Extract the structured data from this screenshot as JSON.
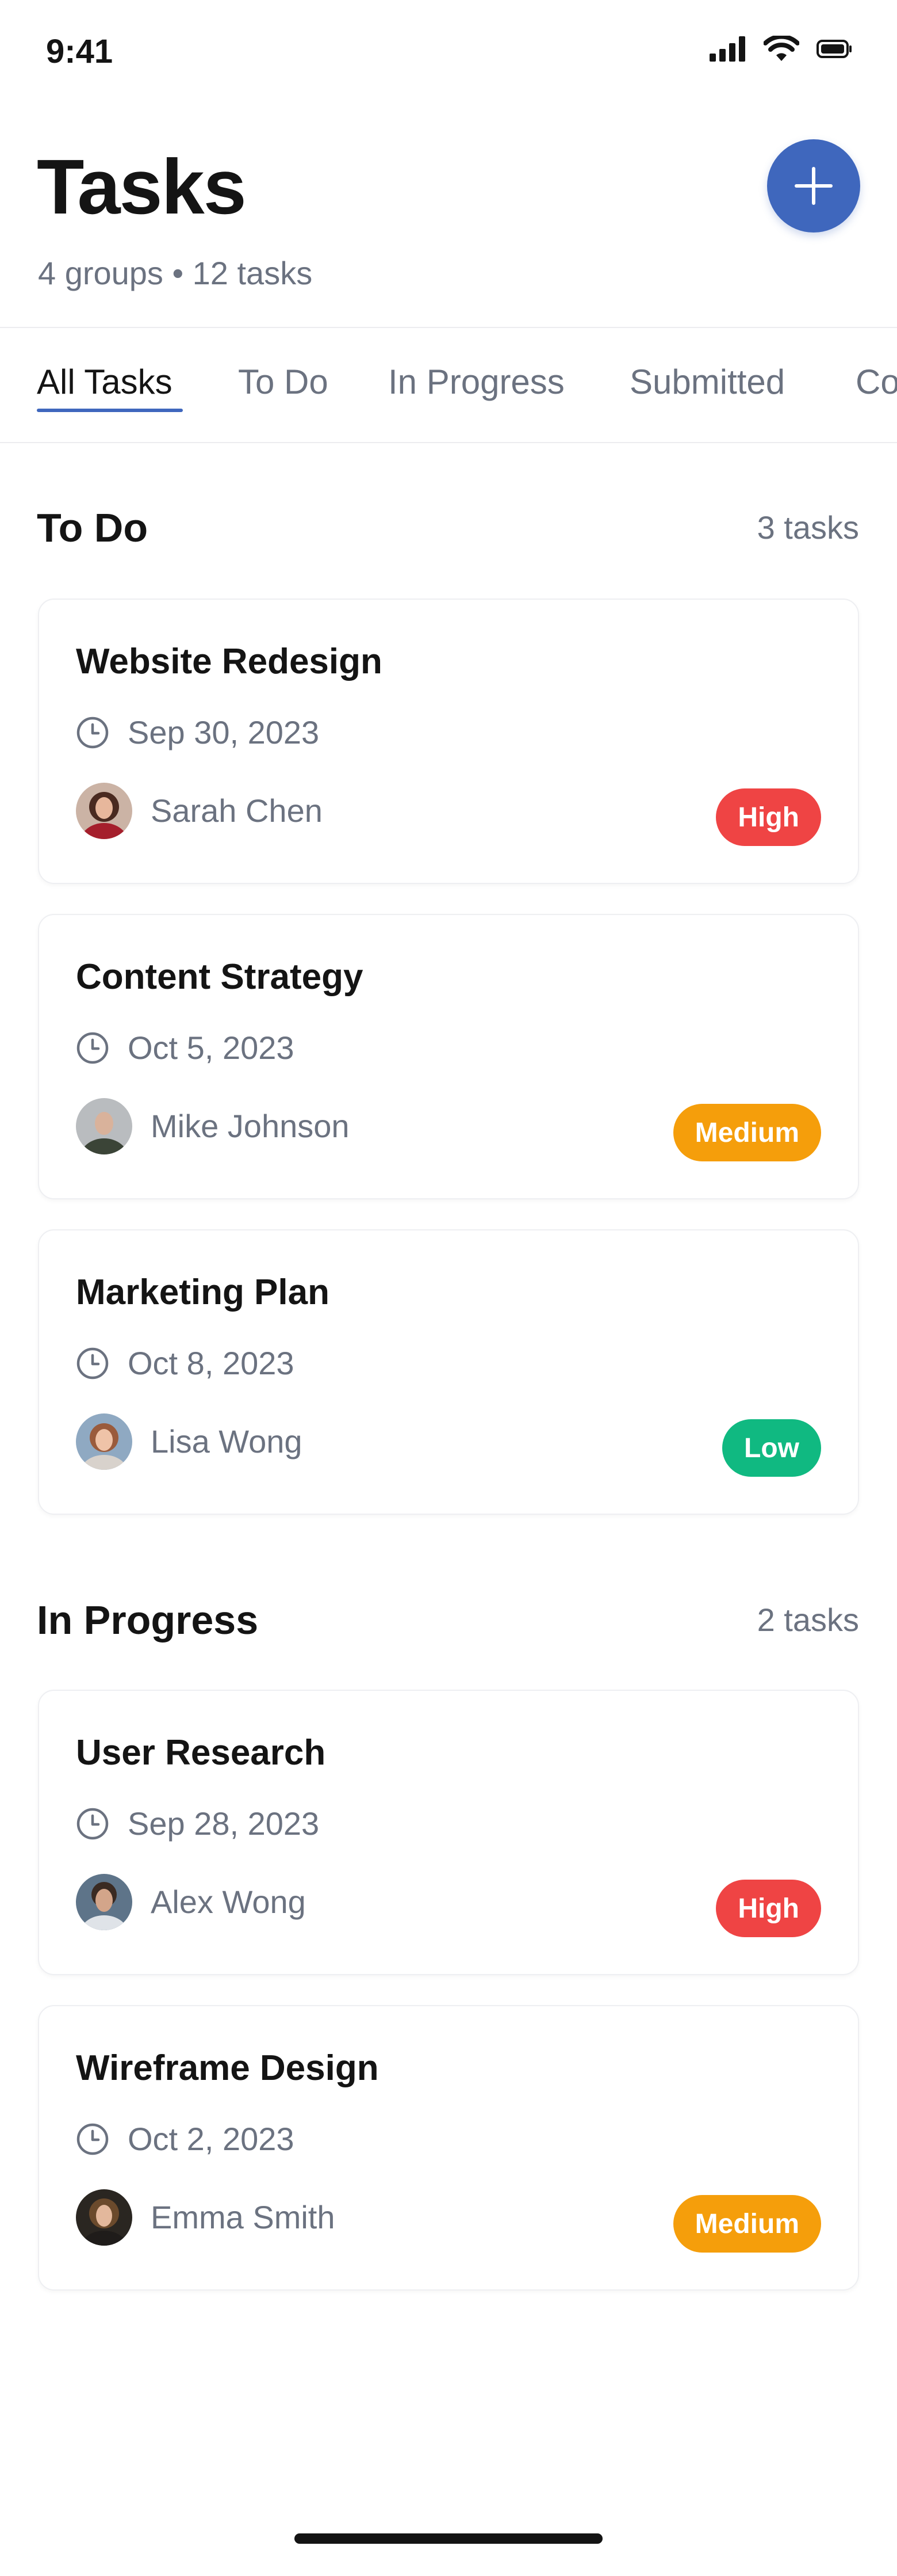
{
  "status_bar": {
    "time": "9:41"
  },
  "header": {
    "title": "Tasks",
    "subtitle": "4 groups • 12 tasks"
  },
  "tabs": [
    {
      "label": "All Tasks",
      "active": true
    },
    {
      "label": "To Do",
      "active": false
    },
    {
      "label": "In Progress",
      "active": false
    },
    {
      "label": "Submitted",
      "active": false
    },
    {
      "label": "Co",
      "active": false
    }
  ],
  "sections": [
    {
      "title": "To Do",
      "count": "3 tasks",
      "tasks": [
        {
          "title": "Website Redesign",
          "date": "Sep 30, 2023",
          "assignee": "Sarah Chen",
          "priority": "High",
          "priority_color": "#ef4444"
        },
        {
          "title": "Content Strategy",
          "date": "Oct 5, 2023",
          "assignee": "Mike Johnson",
          "priority": "Medium",
          "priority_color": "#f59e0b"
        },
        {
          "title": "Marketing Plan",
          "date": "Oct 8, 2023",
          "assignee": "Lisa Wong",
          "priority": "Low",
          "priority_color": "#10b981"
        }
      ]
    },
    {
      "title": "In Progress",
      "count": "2 tasks",
      "tasks": [
        {
          "title": "User Research",
          "date": "Sep 28, 2023",
          "assignee": "Alex Wong",
          "priority": "High",
          "priority_color": "#ef4444"
        },
        {
          "title": "Wireframe Design",
          "date": "Oct 2, 2023",
          "assignee": "Emma Smith",
          "priority": "Medium",
          "priority_color": "#f59e0b"
        }
      ]
    }
  ],
  "icons": {
    "add": "plus-icon",
    "date": "clock-icon",
    "signal": "signal-icon",
    "wifi": "wifi-icon",
    "battery": "battery-icon"
  },
  "colors": {
    "accent": "#3f67bd",
    "high": "#ef4444",
    "medium": "#f59e0b",
    "low": "#10b981"
  }
}
